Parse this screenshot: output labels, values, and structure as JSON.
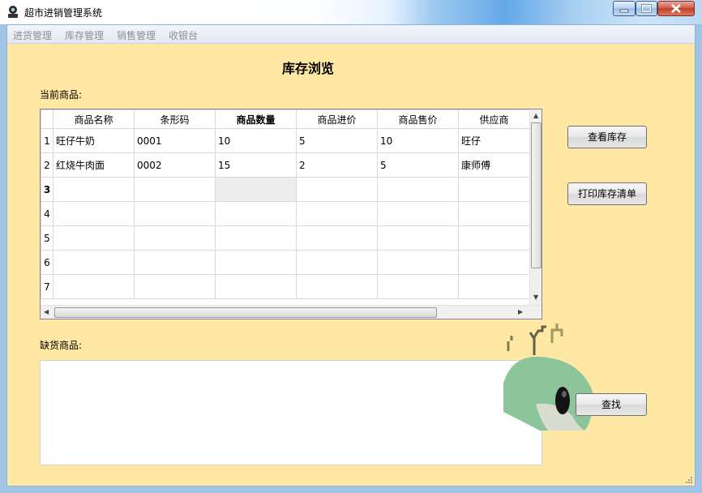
{
  "window": {
    "title": "超市进销管理系统",
    "controls": [
      "minimize",
      "maximize",
      "close"
    ]
  },
  "menu": {
    "items": [
      "进货管理",
      "库存管理",
      "销售管理",
      "收银台"
    ]
  },
  "page": {
    "title": "库存浏览",
    "current_label": "当前商品:",
    "shortage_label": "缺货商品:"
  },
  "grid": {
    "columns": [
      "商品名称",
      "条形码",
      "商品数量",
      "商品进价",
      "商品售价",
      "供应商"
    ],
    "sorted_column": "商品数量",
    "row_numbers": [
      "1",
      "2",
      "3",
      "4",
      "5",
      "6",
      "7"
    ],
    "rows": [
      [
        "旺仔牛奶",
        "0001",
        "10",
        "5",
        "10",
        "旺仔"
      ],
      [
        "红烧牛肉面",
        "0002",
        "15",
        "2",
        "5",
        "康师傅"
      ],
      [
        "",
        "",
        "",
        "",
        "",
        ""
      ],
      [
        "",
        "",
        "",
        "",
        "",
        ""
      ],
      [
        "",
        "",
        "",
        "",
        "",
        ""
      ],
      [
        "",
        "",
        "",
        "",
        "",
        ""
      ],
      [
        "",
        "",
        "",
        "",
        "",
        ""
      ]
    ]
  },
  "buttons": {
    "view_stock": "查看库存",
    "print_stock": "打印库存清单",
    "find": "查找"
  },
  "colors": {
    "client_background": "#ffe8a3",
    "menu_text_disabled": "#8f8f8f"
  }
}
